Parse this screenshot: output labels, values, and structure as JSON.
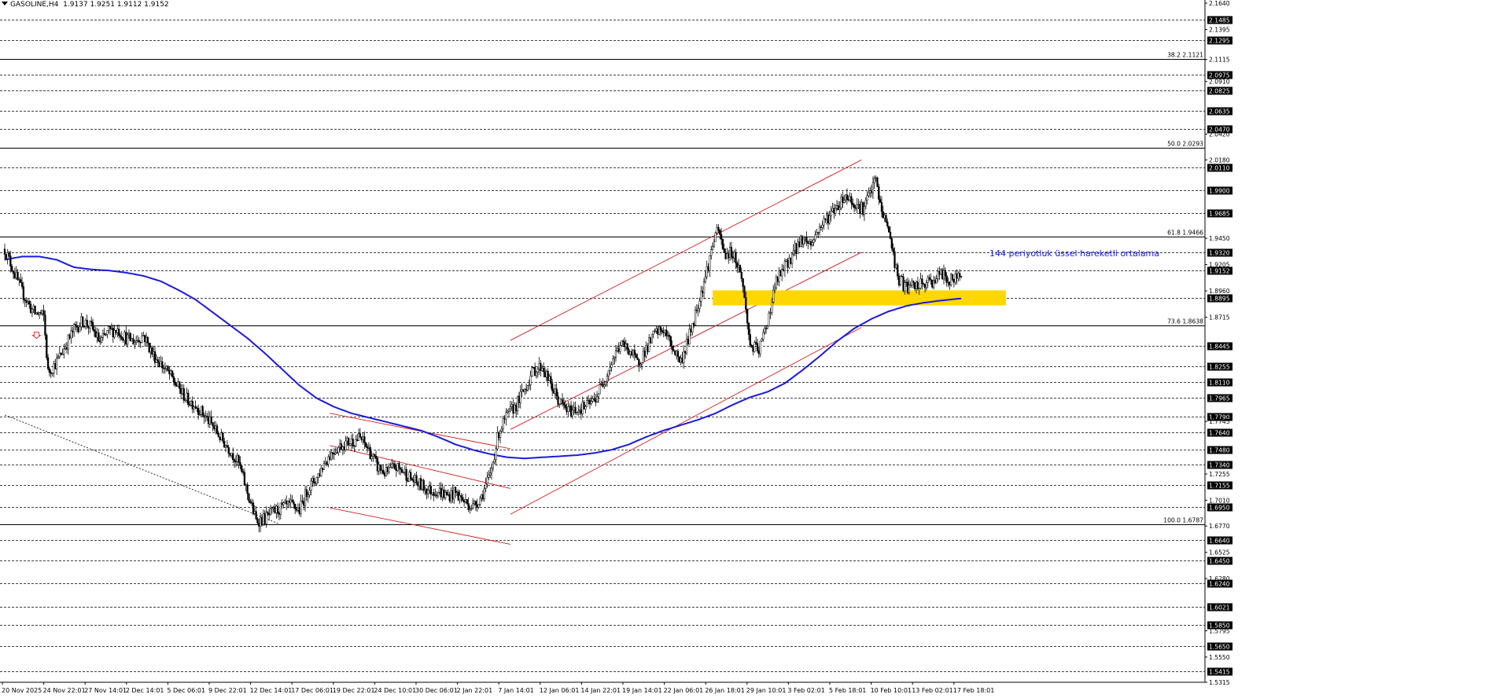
{
  "header": {
    "symbol": "GASOLINE,H4",
    "ohlc": "1.9137 1.9251 1.9112 1.9152"
  },
  "annotation": "144 periyotluk üssel hareketli ortalama",
  "colors": {
    "background": "#ffffff",
    "candle": "#000000",
    "ema": "#1a1adc",
    "channel": "#d02020",
    "support_zone": "#ffd700",
    "grid": "#000000"
  },
  "chart_data": {
    "type": "candlestick",
    "symbol": "GASOLINE",
    "timeframe": "H4",
    "ylim": [
      1.5315,
      2.164
    ],
    "y_scale_labels": [
      "2.1640",
      "2.1395",
      "2.1115",
      "2.0910",
      "2.0420",
      "2.0180",
      "1.9450",
      "1.9205",
      "1.8960",
      "1.8715",
      "1.7745",
      "1.7255",
      "1.7010",
      "1.6770",
      "1.6525",
      "1.6280",
      "1.5795",
      "1.5550",
      "1.5315"
    ],
    "price_lines": [
      "2.1485",
      "2.1295",
      "2.0975",
      "2.0825",
      "2.0635",
      "2.0470",
      "2.0110",
      "1.9900",
      "1.9685",
      "1.9320",
      "1.9152",
      "1.8895",
      "1.8445",
      "1.8255",
      "1.8110",
      "1.7965",
      "1.7790",
      "1.7640",
      "1.7480",
      "1.7340",
      "1.7155",
      "1.6950",
      "1.6640",
      "1.6450",
      "1.6240",
      "1.6021",
      "1.5850",
      "1.5650",
      "1.5415"
    ],
    "fibonacci": [
      {
        "level": "38.2",
        "price": "2.1121"
      },
      {
        "level": "50.0",
        "price": "2.0293"
      },
      {
        "level": "61.8",
        "price": "1.9466"
      },
      {
        "level": "73.6",
        "price": "1.8638"
      },
      {
        "level": "100.0",
        "price": "1.6787"
      }
    ],
    "x_labels": [
      "20 Nov 2025",
      "24 Nov 22:01",
      "27 Nov 14:01",
      "2 Dec 14:01",
      "5 Dec 06:01",
      "9 Dec 22:01",
      "12 Dec 14:01",
      "17 Dec 06:01",
      "19 Dec 22:01",
      "24 Dec 10:01",
      "30 Dec 06:01",
      "2 Jan 22:01",
      "7 Jan 14:01",
      "12 Jan 06:01",
      "14 Jan 22:01",
      "19 Jan 14:01",
      "22 Jan 06:01",
      "26 Jan 18:01",
      "29 Jan 10:01",
      "3 Feb 02:01",
      "5 Feb 18:01",
      "10 Feb 10:01",
      "13 Feb 02:01",
      "17 Feb 18:01"
    ],
    "close_path": [
      [
        0,
        1.935
      ],
      [
        6,
        1.915
      ],
      [
        12,
        1.895
      ],
      [
        18,
        1.88
      ],
      [
        21,
        1.875
      ],
      [
        24,
        1.875
      ],
      [
        27,
        1.872
      ],
      [
        30,
        1.82
      ],
      [
        36,
        1.83
      ],
      [
        42,
        1.845
      ],
      [
        48,
        1.86
      ],
      [
        54,
        1.868
      ],
      [
        60,
        1.862
      ],
      [
        66,
        1.848
      ],
      [
        72,
        1.858
      ],
      [
        78,
        1.86
      ],
      [
        84,
        1.852
      ],
      [
        90,
        1.849
      ],
      [
        96,
        1.855
      ],
      [
        102,
        1.838
      ],
      [
        108,
        1.828
      ],
      [
        114,
        1.818
      ],
      [
        120,
        1.806
      ],
      [
        126,
        1.795
      ],
      [
        132,
        1.79
      ],
      [
        138,
        1.78
      ],
      [
        144,
        1.77
      ],
      [
        150,
        1.758
      ],
      [
        156,
        1.748
      ],
      [
        162,
        1.735
      ],
      [
        168,
        1.708
      ],
      [
        174,
        1.682
      ],
      [
        180,
        1.684
      ],
      [
        186,
        1.69
      ],
      [
        192,
        1.694
      ],
      [
        198,
        1.696
      ],
      [
        204,
        1.692
      ],
      [
        210,
        1.712
      ],
      [
        216,
        1.722
      ],
      [
        222,
        1.738
      ],
      [
        228,
        1.748
      ],
      [
        234,
        1.753
      ],
      [
        240,
        1.756
      ],
      [
        246,
        1.759
      ],
      [
        252,
        1.748
      ],
      [
        258,
        1.732
      ],
      [
        264,
        1.726
      ],
      [
        270,
        1.732
      ],
      [
        276,
        1.728
      ],
      [
        282,
        1.72
      ],
      [
        288,
        1.715
      ],
      [
        294,
        1.71
      ],
      [
        300,
        1.71
      ],
      [
        306,
        1.705
      ],
      [
        312,
        1.708
      ],
      [
        318,
        1.7
      ],
      [
        324,
        1.695
      ],
      [
        330,
        1.705
      ],
      [
        336,
        1.724
      ],
      [
        342,
        1.765
      ],
      [
        348,
        1.78
      ],
      [
        354,
        1.79
      ],
      [
        360,
        1.805
      ],
      [
        366,
        1.822
      ],
      [
        372,
        1.826
      ],
      [
        378,
        1.808
      ],
      [
        384,
        1.792
      ],
      [
        390,
        1.784
      ],
      [
        396,
        1.786
      ],
      [
        402,
        1.788
      ],
      [
        408,
        1.794
      ],
      [
        414,
        1.81
      ],
      [
        420,
        1.83
      ],
      [
        426,
        1.846
      ],
      [
        432,
        1.842
      ],
      [
        438,
        1.828
      ],
      [
        444,
        1.842
      ],
      [
        450,
        1.856
      ],
      [
        456,
        1.86
      ],
      [
        462,
        1.844
      ],
      [
        468,
        1.83
      ],
      [
        474,
        1.855
      ],
      [
        480,
        1.885
      ],
      [
        486,
        1.915
      ],
      [
        492,
        1.95
      ],
      [
        495,
        1.948
      ],
      [
        498,
        1.93
      ],
      [
        504,
        1.932
      ],
      [
        510,
        1.91
      ],
      [
        516,
        1.845
      ],
      [
        522,
        1.84
      ],
      [
        528,
        1.868
      ],
      [
        534,
        1.905
      ],
      [
        540,
        1.918
      ],
      [
        546,
        1.932
      ],
      [
        552,
        1.945
      ],
      [
        558,
        1.94
      ],
      [
        564,
        1.955
      ],
      [
        570,
        1.965
      ],
      [
        576,
        1.975
      ],
      [
        582,
        1.985
      ],
      [
        588,
        1.978
      ],
      [
        594,
        1.972
      ],
      [
        600,
        1.99
      ],
      [
        603,
        2.0
      ],
      [
        606,
        1.975
      ],
      [
        612,
        1.952
      ],
      [
        618,
        1.908
      ],
      [
        624,
        1.899
      ],
      [
        630,
        1.9
      ],
      [
        636,
        1.902
      ],
      [
        642,
        1.905
      ],
      [
        648,
        1.912
      ],
      [
        654,
        1.905
      ],
      [
        660,
        1.909
      ],
      [
        662,
        1.915
      ]
    ],
    "ema_144": [
      [
        0,
        1.925
      ],
      [
        12,
        1.928
      ],
      [
        24,
        1.928
      ],
      [
        36,
        1.925
      ],
      [
        48,
        1.918
      ],
      [
        60,
        1.916
      ],
      [
        72,
        1.915
      ],
      [
        84,
        1.913
      ],
      [
        96,
        1.91
      ],
      [
        108,
        1.905
      ],
      [
        120,
        1.897
      ],
      [
        132,
        1.888
      ],
      [
        144,
        1.876
      ],
      [
        156,
        1.864
      ],
      [
        168,
        1.852
      ],
      [
        180,
        1.838
      ],
      [
        192,
        1.823
      ],
      [
        204,
        1.808
      ],
      [
        216,
        1.796
      ],
      [
        228,
        1.788
      ],
      [
        240,
        1.782
      ],
      [
        252,
        1.778
      ],
      [
        264,
        1.774
      ],
      [
        276,
        1.77
      ],
      [
        288,
        1.766
      ],
      [
        300,
        1.76
      ],
      [
        312,
        1.753
      ],
      [
        324,
        1.748
      ],
      [
        336,
        1.744
      ],
      [
        348,
        1.741
      ],
      [
        360,
        1.74
      ],
      [
        372,
        1.741
      ],
      [
        384,
        1.742
      ],
      [
        396,
        1.743
      ],
      [
        408,
        1.745
      ],
      [
        420,
        1.748
      ],
      [
        432,
        1.753
      ],
      [
        444,
        1.76
      ],
      [
        456,
        1.766
      ],
      [
        468,
        1.771
      ],
      [
        480,
        1.776
      ],
      [
        492,
        1.782
      ],
      [
        504,
        1.79
      ],
      [
        516,
        1.797
      ],
      [
        528,
        1.802
      ],
      [
        540,
        1.81
      ],
      [
        552,
        1.822
      ],
      [
        564,
        1.835
      ],
      [
        576,
        1.849
      ],
      [
        588,
        1.861
      ],
      [
        600,
        1.87
      ],
      [
        612,
        1.877
      ],
      [
        624,
        1.882
      ],
      [
        636,
        1.885
      ],
      [
        648,
        1.887
      ],
      [
        662,
        1.889
      ]
    ],
    "n_bars": 663
  }
}
